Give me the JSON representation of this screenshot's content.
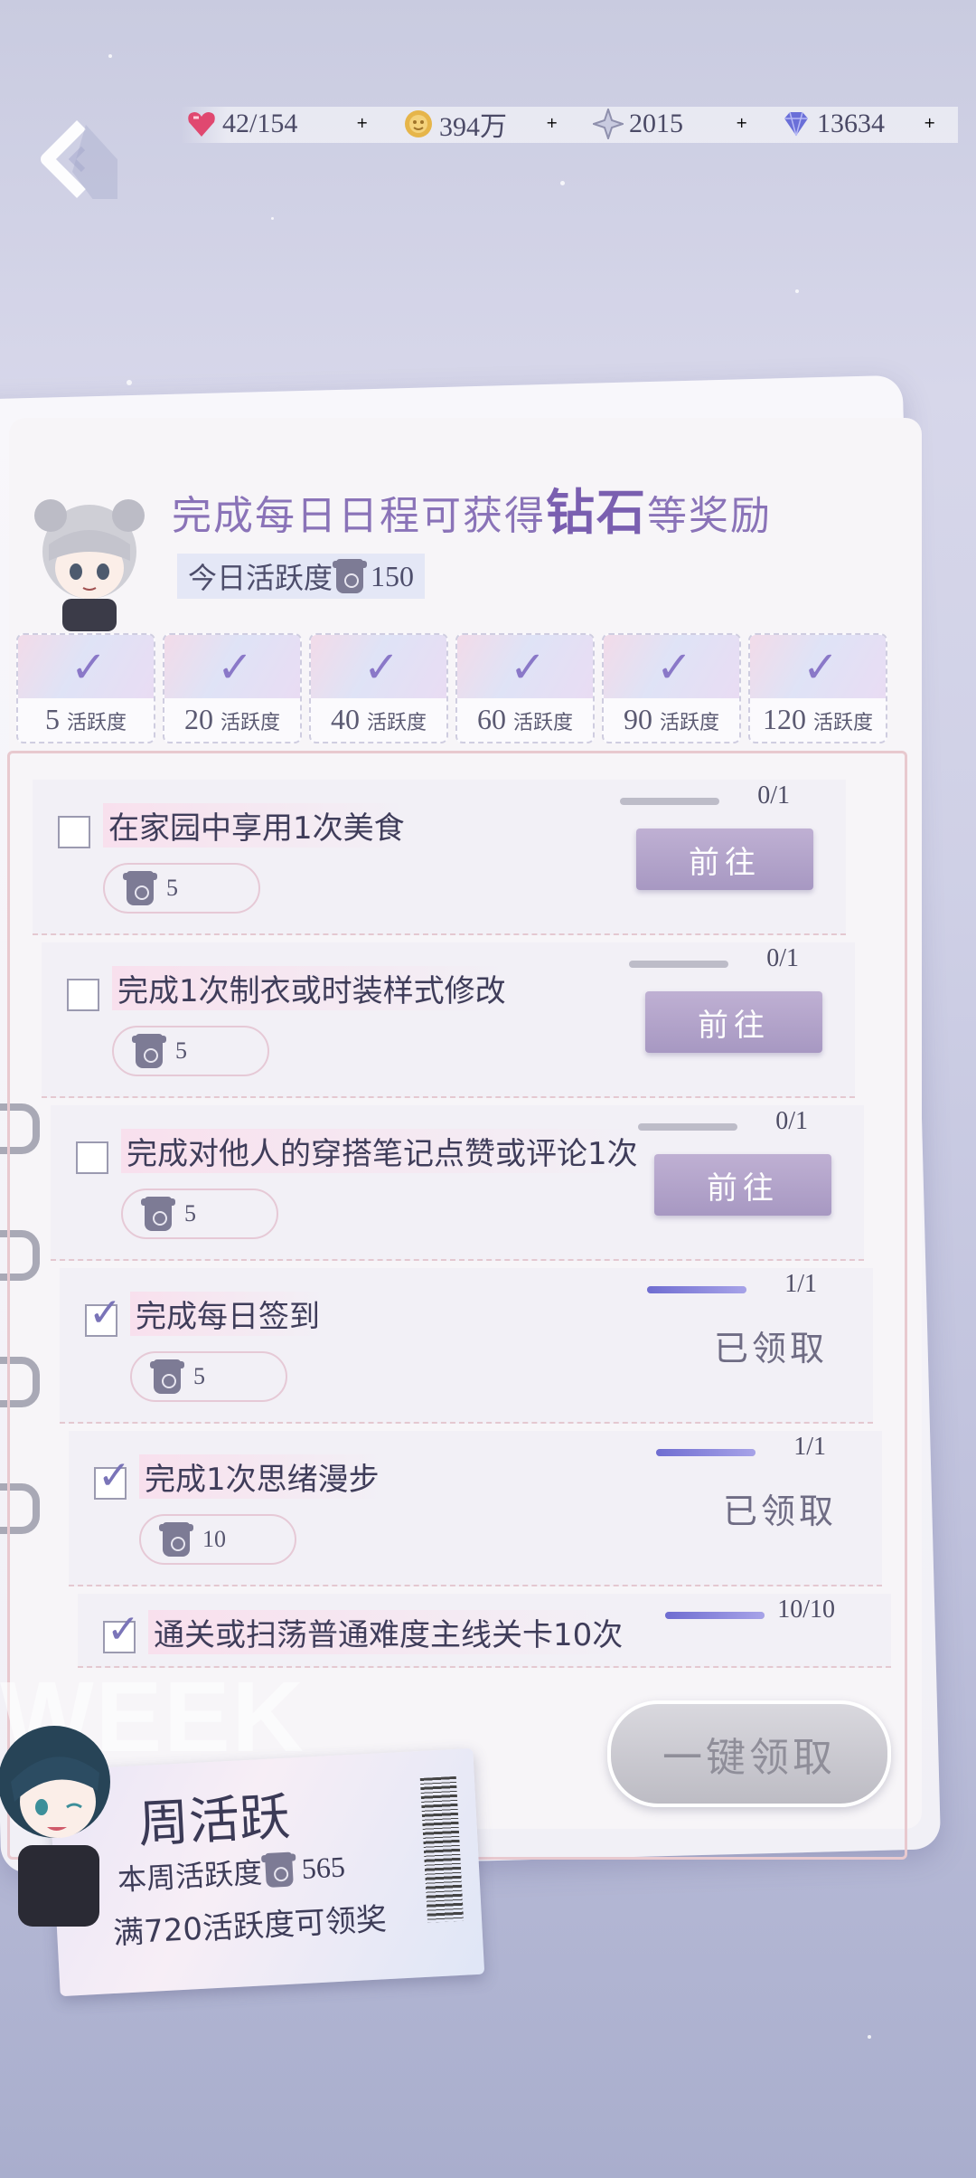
{
  "resources": [
    {
      "icon": "heart-gem-icon",
      "value": "42/154",
      "plus": "+"
    },
    {
      "icon": "gold-coin-icon",
      "value": "394万",
      "plus": "+"
    },
    {
      "icon": "crystal-star-icon",
      "value": "2015",
      "plus": "+"
    },
    {
      "icon": "diamond-icon",
      "value": "13634",
      "plus": "+"
    }
  ],
  "header": {
    "title_part1": "完成每日日程可获得",
    "title_emph": "钻石",
    "title_part2": "等奖励",
    "today_label": "今日活跃度",
    "today_value": "150"
  },
  "milestones": [
    {
      "value": "5",
      "unit": "活跃度"
    },
    {
      "value": "20",
      "unit": "活跃度"
    },
    {
      "value": "40",
      "unit": "活跃度"
    },
    {
      "value": "60",
      "unit": "活跃度"
    },
    {
      "value": "90",
      "unit": "活跃度"
    },
    {
      "value": "120",
      "unit": "活跃度"
    }
  ],
  "tasks": [
    {
      "name": "在家园中享用1次美食",
      "reward": "5",
      "progress": "0/1",
      "fill": 0,
      "done": false,
      "action": "前往"
    },
    {
      "name": "完成1次制衣或时装样式修改",
      "reward": "5",
      "progress": "0/1",
      "fill": 0,
      "done": false,
      "action": "前往"
    },
    {
      "name": "完成对他人的穿搭笔记点赞或评论1次",
      "reward": "5",
      "progress": "0/1",
      "fill": 0,
      "done": false,
      "action": "前往"
    },
    {
      "name": "完成每日签到",
      "reward": "5",
      "progress": "1/1",
      "fill": 1,
      "done": true,
      "action": "已领取"
    },
    {
      "name": "完成1次思绪漫步",
      "reward": "10",
      "progress": "1/1",
      "fill": 1,
      "done": true,
      "action": "已领取"
    },
    {
      "name": "通关或扫荡普通难度主线关卡10次",
      "reward": "",
      "progress": "10/10",
      "fill": 1,
      "done": true,
      "action": ""
    }
  ],
  "claim_all": "一键领取",
  "weekly": {
    "bg_text": "WEEK",
    "title": "周活跃",
    "activity_label": "本周活跃度",
    "activity_value": "565",
    "reward_note": "满720活跃度可领奖"
  }
}
